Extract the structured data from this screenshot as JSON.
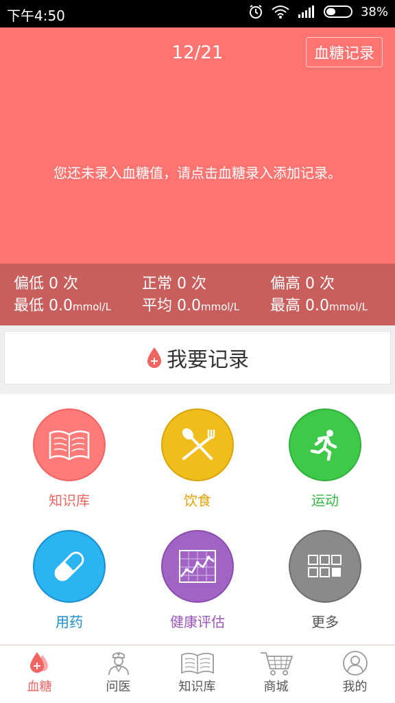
{
  "status_bar": {
    "time": "下午4:50",
    "battery": "38%",
    "battery_level": 0.38
  },
  "header": {
    "date": "12/21",
    "record_button": "血糖记录",
    "empty_message": "您还未录入血糖值，请点击血糖录入添加记录。"
  },
  "stats": {
    "low_count": "偏低 0 次",
    "normal_count": "正常 0 次",
    "high_count": "偏高 0 次",
    "min_label": "最低 0.0",
    "avg_label": "平均 0.0",
    "max_label": "最高 0.0",
    "unit": "mmol/L"
  },
  "record_card": {
    "label": "我要记录"
  },
  "grid": [
    {
      "label": "知识库",
      "icon": "book-icon",
      "color": "#ff7b79",
      "label_color": "#f06461"
    },
    {
      "label": "饮食",
      "icon": "fork-spoon-icon",
      "color": "#f0bd1a",
      "label_color": "#e6a200"
    },
    {
      "label": "运动",
      "icon": "running-man-icon",
      "color": "#3ec94a",
      "label_color": "#35b842"
    },
    {
      "label": "用药",
      "icon": "pill-icon",
      "color": "#2ab4f1",
      "label_color": "#1a8fcf"
    },
    {
      "label": "健康评估",
      "icon": "chart-icon",
      "color": "#a264c4",
      "label_color": "#9a54bd"
    },
    {
      "label": "更多",
      "icon": "grid-icon",
      "color": "#8a8a8a",
      "label_color": "#555555"
    }
  ],
  "tabbar": [
    {
      "label": "血糖",
      "icon": "blood-drop-icon",
      "active": true
    },
    {
      "label": "问医",
      "icon": "doctor-icon"
    },
    {
      "label": "知识库",
      "icon": "book-icon"
    },
    {
      "label": "商城",
      "icon": "cart-icon"
    },
    {
      "label": "我的",
      "icon": "user-icon"
    }
  ],
  "colors": {
    "accent": "#ff7370",
    "stats_bg": "#c95f5d"
  }
}
